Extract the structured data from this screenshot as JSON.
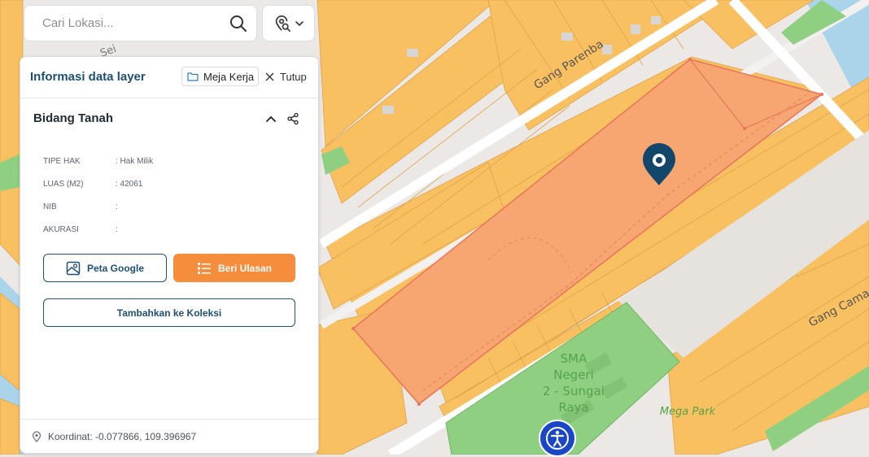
{
  "search": {
    "placeholder": "Cari Lokasi..."
  },
  "panel": {
    "title": "Informasi data layer",
    "workspace_label": "Meja Kerja",
    "close_label": "Tutup",
    "section_title": "Bidang Tanah",
    "attributes": [
      {
        "key": "TIPE HAK",
        "value": ": Hak Milik"
      },
      {
        "key": "LUAS (M2)",
        "value": ": 42061"
      },
      {
        "key": "NIB",
        "value": ":"
      },
      {
        "key": "AKURASI",
        "value": ":"
      }
    ],
    "google_label": "Peta Google",
    "review_label": "Beri Ulasan",
    "collection_label": "Tambahkan ke Koleksi",
    "coordinate_text": "Koordinat: -0.077866, 109.396967"
  },
  "map": {
    "street_gang_parenba": "Gang Parenba",
    "street_gang_cama": "Gang Cama",
    "street_partial": "Sei",
    "school_line1": "SMA",
    "school_line2": "Negeri",
    "school_line3": "2 - Sungai",
    "school_line4": "Raya",
    "poi_mega_park": "Mega Park"
  },
  "colors": {
    "parcel_orange": "#f8c060",
    "selected_parcel": "#f7a571",
    "park_green": "#8fcf81",
    "accent_blue": "#1f4f73",
    "review_orange": "#f58d3c",
    "marker": "#12466b"
  }
}
